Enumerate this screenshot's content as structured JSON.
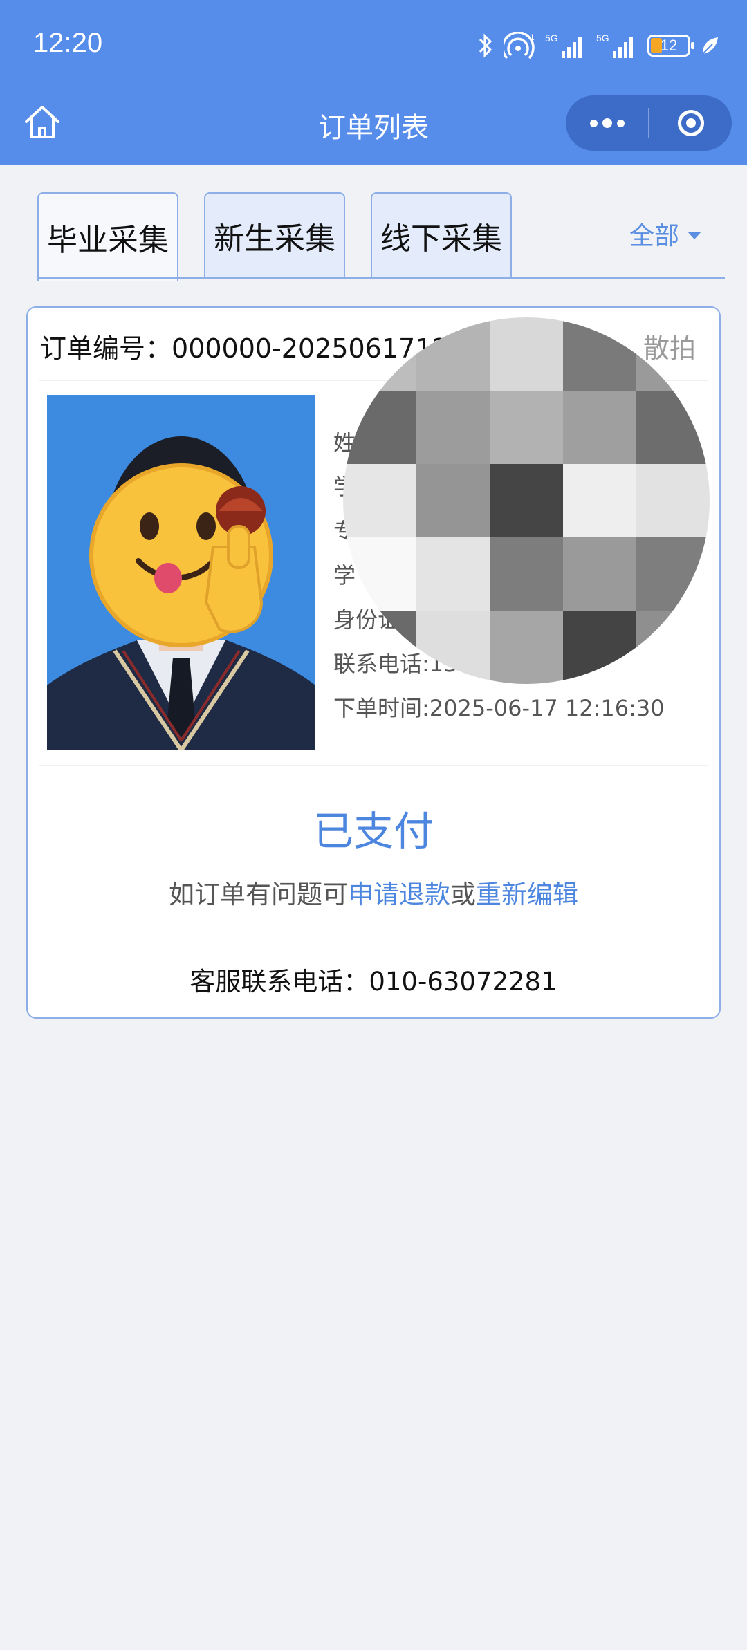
{
  "status_bar": {
    "time": "12:20",
    "battery": "12",
    "signal_label_1": "5G",
    "signal_label_2": "5G"
  },
  "navbar": {
    "title": "订单列表"
  },
  "tabs": [
    {
      "label": "毕业采集",
      "active": true
    },
    {
      "label": "新生采集",
      "active": false
    },
    {
      "label": "线下采集",
      "active": false
    }
  ],
  "filter": {
    "label": "全部"
  },
  "order": {
    "number_label": "订单编号：",
    "number": "000000-20250617123",
    "type": "散拍",
    "info_lines": [
      "姓",
      "学",
      "专",
      "学",
      "身份证",
      "联系电话:13",
      "下单时间:2025-06-17 12:16:30"
    ],
    "status": "已支付",
    "hint_prefix": "如订单有问题可",
    "refund_link": "申请退款",
    "hint_or": "或",
    "edit_link": "重新编辑",
    "service_phone": "客服联系电话：010-63072281"
  },
  "colors": {
    "header": "#568cea",
    "accent": "#4d86de",
    "page_bg": "#f0f2f6"
  },
  "icons": {
    "home": "home-icon",
    "more": "more-dots-icon",
    "close": "target-close-icon",
    "bluetooth": "bluetooth-icon",
    "hotspot": "hotspot-icon",
    "signal": "signal-bars-icon",
    "battery": "battery-icon",
    "leaf": "leaf-icon",
    "caret": "caret-down-icon"
  }
}
